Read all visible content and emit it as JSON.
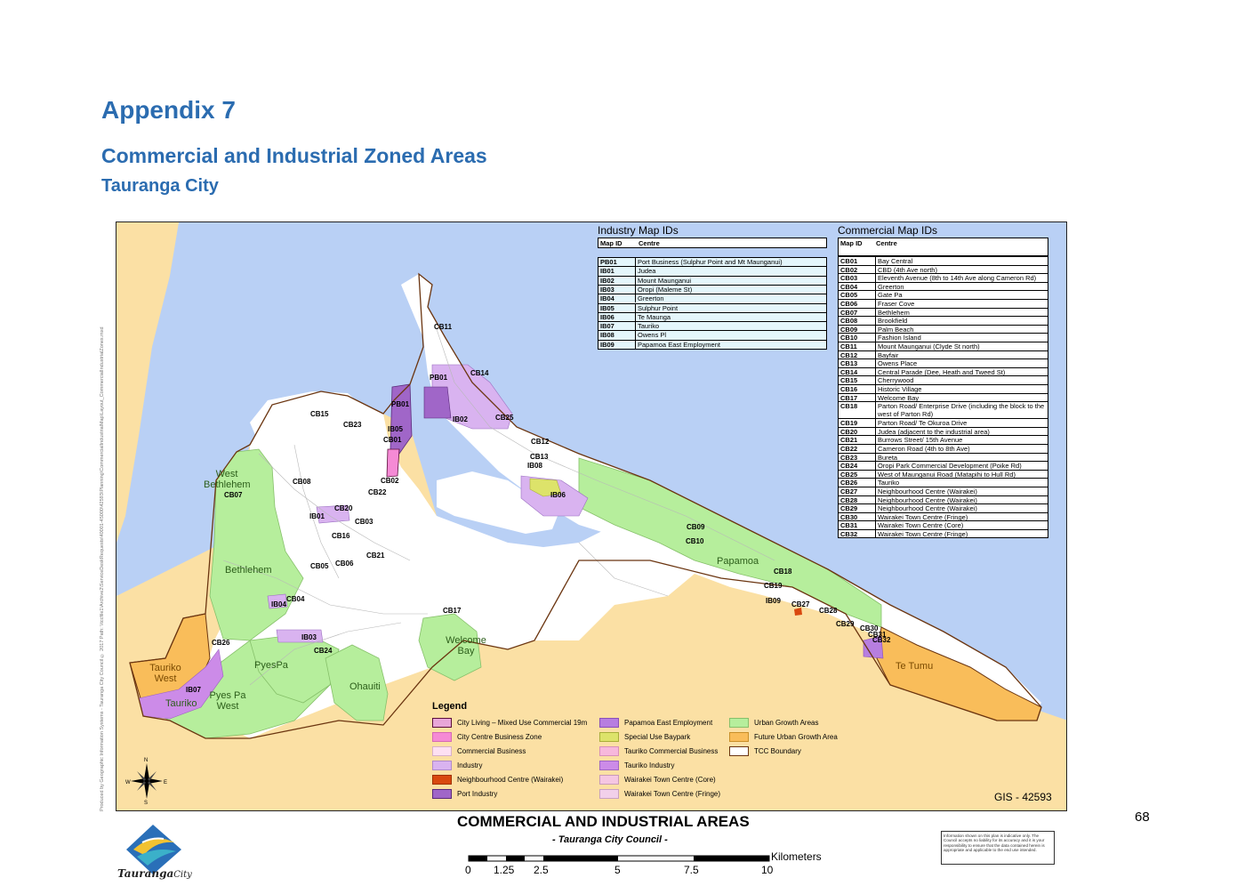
{
  "header": {
    "appendix": "Appendix 7",
    "title": "Commercial and Industrial Zoned Areas",
    "subtitle": "Tauranga City"
  },
  "page_number": "68",
  "side_credit": "Produced by Geographic Information Systems - Tauranga City Council © 2017    Path: \\\\tccfile1\\Archive2\\ServiceDeskRequests\\40001-45000\\42593\\Planning\\CommercialIndustrialMap\\Layout_CommercialIndustrialZones.mxd",
  "industry_table": {
    "title": "Industry Map IDs",
    "col_id": "Map ID",
    "col_centre": "Centre",
    "rows": [
      {
        "id": "PB01",
        "centre": "Port Business (Sulphur Point and Mt Maunganui)"
      },
      {
        "id": "IB01",
        "centre": "Judea"
      },
      {
        "id": "IB02",
        "centre": "Mount Maunganui"
      },
      {
        "id": "IB03",
        "centre": "Oropi (Maleme St)"
      },
      {
        "id": "IB04",
        "centre": "Greerton"
      },
      {
        "id": "IB05",
        "centre": "Sulphur Point"
      },
      {
        "id": "IB06",
        "centre": "Te Maunga"
      },
      {
        "id": "IB07",
        "centre": "Tauriko"
      },
      {
        "id": "IB08",
        "centre": "Owens Pl"
      },
      {
        "id": "IB09",
        "centre": "Papamoa East Employment"
      }
    ]
  },
  "commercial_table": {
    "title": "Commercial Map IDs",
    "col_id": "Map ID",
    "col_centre": "Centre",
    "rows": [
      {
        "id": "CB01",
        "centre": "Bay Central"
      },
      {
        "id": "CB02",
        "centre": "CBD (4th Ave north)"
      },
      {
        "id": "CB03",
        "centre": "Eleventh Avenue (8th to 14th Ave along Cameron Rd)"
      },
      {
        "id": "CB04",
        "centre": "Greerton"
      },
      {
        "id": "CB05",
        "centre": "Gate Pa"
      },
      {
        "id": "CB06",
        "centre": "Fraser Cove"
      },
      {
        "id": "CB07",
        "centre": "Bethlehem"
      },
      {
        "id": "CB08",
        "centre": "Brookfield"
      },
      {
        "id": "CB09",
        "centre": "Palm Beach"
      },
      {
        "id": "CB10",
        "centre": "Fashion Island"
      },
      {
        "id": "CB11",
        "centre": "Mount Maunganui (Clyde St north)"
      },
      {
        "id": "CB12",
        "centre": "Bayfair"
      },
      {
        "id": "CB13",
        "centre": "Owens Place"
      },
      {
        "id": "CB14",
        "centre": "Central Parade (Dee, Heath and Tweed St)"
      },
      {
        "id": "CB15",
        "centre": "Cherrywood"
      },
      {
        "id": "CB16",
        "centre": "Historic Village"
      },
      {
        "id": "CB17",
        "centre": "Welcome Bay"
      },
      {
        "id": "CB18",
        "centre": "Parton Road/ Enterprise Drive (including the block to the west of Parton Rd)"
      },
      {
        "id": "CB19",
        "centre": "Parton Road/ Te Okuroa Drive"
      },
      {
        "id": "CB20",
        "centre": "Judea (adjacent to the industrial area)"
      },
      {
        "id": "CB21",
        "centre": "Burrows Street/ 15th Avenue"
      },
      {
        "id": "CB22",
        "centre": "Cameron Road (4th to 8th Ave)"
      },
      {
        "id": "CB23",
        "centre": "Bureta"
      },
      {
        "id": "CB24",
        "centre": "Oropi Park Commercial Development (Poike Rd)"
      },
      {
        "id": "CB25",
        "centre": "West of Maunganui Road (Matapihi to Hull Rd)"
      },
      {
        "id": "CB26",
        "centre": "Tauriko"
      },
      {
        "id": "CB27",
        "centre": "Neighbourhood Centre (Wairakei)"
      },
      {
        "id": "CB28",
        "centre": "Neighbourhood Centre (Wairakei)"
      },
      {
        "id": "CB29",
        "centre": "Neighbourhood Centre (Wairakei)"
      },
      {
        "id": "CB30",
        "centre": "Wairakei Town Centre (Fringe)"
      },
      {
        "id": "CB31",
        "centre": "Wairakei Town Centre (Core)"
      },
      {
        "id": "CB32",
        "centre": "Wairakei Town Centre (Fringe)"
      }
    ]
  },
  "map_labels": {
    "ids": [
      {
        "text": "CB11"
      },
      {
        "text": "CB14"
      },
      {
        "text": "PB01"
      },
      {
        "text": "PB01"
      },
      {
        "text": "IB02"
      },
      {
        "text": "CB25"
      },
      {
        "text": "CB15"
      },
      {
        "text": "CB23"
      },
      {
        "text": "IB05"
      },
      {
        "text": "CB01"
      },
      {
        "text": "CB12"
      },
      {
        "text": "CB13"
      },
      {
        "text": "IB08"
      },
      {
        "text": "CB08"
      },
      {
        "text": "CB02"
      },
      {
        "text": "CB22"
      },
      {
        "text": "IB06"
      },
      {
        "text": "CB07"
      },
      {
        "text": "CB20"
      },
      {
        "text": "IB01"
      },
      {
        "text": "CB03"
      },
      {
        "text": "CB16"
      },
      {
        "text": "CB09"
      },
      {
        "text": "CB10"
      },
      {
        "text": "CB21"
      },
      {
        "text": "CB05"
      },
      {
        "text": "CB06"
      },
      {
        "text": "CB18"
      },
      {
        "text": "CB19"
      },
      {
        "text": "CB04"
      },
      {
        "text": "IB04"
      },
      {
        "text": "IB09"
      },
      {
        "text": "CB27"
      },
      {
        "text": "CB28"
      },
      {
        "text": "CB17"
      },
      {
        "text": "IB03"
      },
      {
        "text": "CB29"
      },
      {
        "text": "CB30"
      },
      {
        "text": "CB31"
      },
      {
        "text": "CB32"
      },
      {
        "text": "CB26"
      },
      {
        "text": "CB24"
      },
      {
        "text": "IB07"
      }
    ],
    "areas": [
      {
        "text": "West Bethlehem"
      },
      {
        "text": "Bethlehem"
      },
      {
        "text": "Papamoa"
      },
      {
        "text": "Welcome Bay"
      },
      {
        "text": "PyesPa"
      },
      {
        "text": "Ohauiti"
      },
      {
        "text": "Pyes Pa West"
      },
      {
        "text": "Tauriko West"
      },
      {
        "text": "Tauriko"
      },
      {
        "text": "Te Tumu"
      }
    ]
  },
  "legend": {
    "title": "Legend",
    "items": [
      {
        "label": "City Living – Mixed Use Commercial 19m",
        "color": "#e8a6d8",
        "border": "#5a0f3a"
      },
      {
        "label": "City Centre Business Zone",
        "color": "#f58ad5",
        "border": "#d56ab5"
      },
      {
        "label": "Commercial Business",
        "color": "#fde0f2",
        "border": "#d8b0c8"
      },
      {
        "label": "Industry",
        "color": "#d9b3f0",
        "border": "#b08ac8"
      },
      {
        "label": "Neighbourhood Centre (Wairakei)",
        "color": "#d9480f",
        "border": "#a03000"
      },
      {
        "label": "Port Industry",
        "color": "#a066c8",
        "border": "#5a2a7a"
      },
      {
        "label": "Papamoa East Employment",
        "color": "#b77ee0",
        "border": "#8a50b8"
      },
      {
        "label": "Special Use Baypark",
        "color": "#dde36a",
        "border": "#a8ae3a"
      },
      {
        "label": "Tauriko Commercial Business",
        "color": "#f7b8dc",
        "border": "#d890b8"
      },
      {
        "label": "Tauriko Industry",
        "color": "#cc8be8",
        "border": "#a066c0"
      },
      {
        "label": "Wairakei Town Centre (Core)",
        "color": "#f5c6e2",
        "border": "#c89ab8"
      },
      {
        "label": "Wairakei Town Centre (Fringe)",
        "color": "#f2d0ea",
        "border": "#c8a0c0"
      },
      {
        "label": "Urban Growth Areas",
        "color": "#b6ee9c",
        "border": "#86c06a"
      },
      {
        "label": "Future Urban Growth Area",
        "color": "#f9bd5a",
        "border": "#c8902a"
      },
      {
        "label": "TCC Boundary",
        "color": "#ffffff",
        "border": "#6b3510"
      }
    ]
  },
  "gis_id": "GIS - 42593",
  "footer": {
    "title": "COMMERCIAL AND INDUSTRIAL AREAS",
    "subtitle": "- Tauranga City Council -",
    "scale_ticks": [
      "0",
      "1.25",
      "2.5",
      "5",
      "7.5",
      "10"
    ],
    "scale_unit": "Kilometers",
    "disclaimer": "Information shown on this plan is indicative only. The Council accepts no liability for its accuracy and it is your responsibility to ensure that the data contained herein is appropriate and applicable to the end use intended.",
    "logo_name": "Tauranga",
    "logo_suffix": "City"
  },
  "colors": {
    "water": "#b9d0f5",
    "land": "#fbe0a4",
    "urban": "#ffffff",
    "urban_growth": "#b6ee9c",
    "future_growth": "#f9bd5a",
    "heading": "#2b6cb0"
  }
}
